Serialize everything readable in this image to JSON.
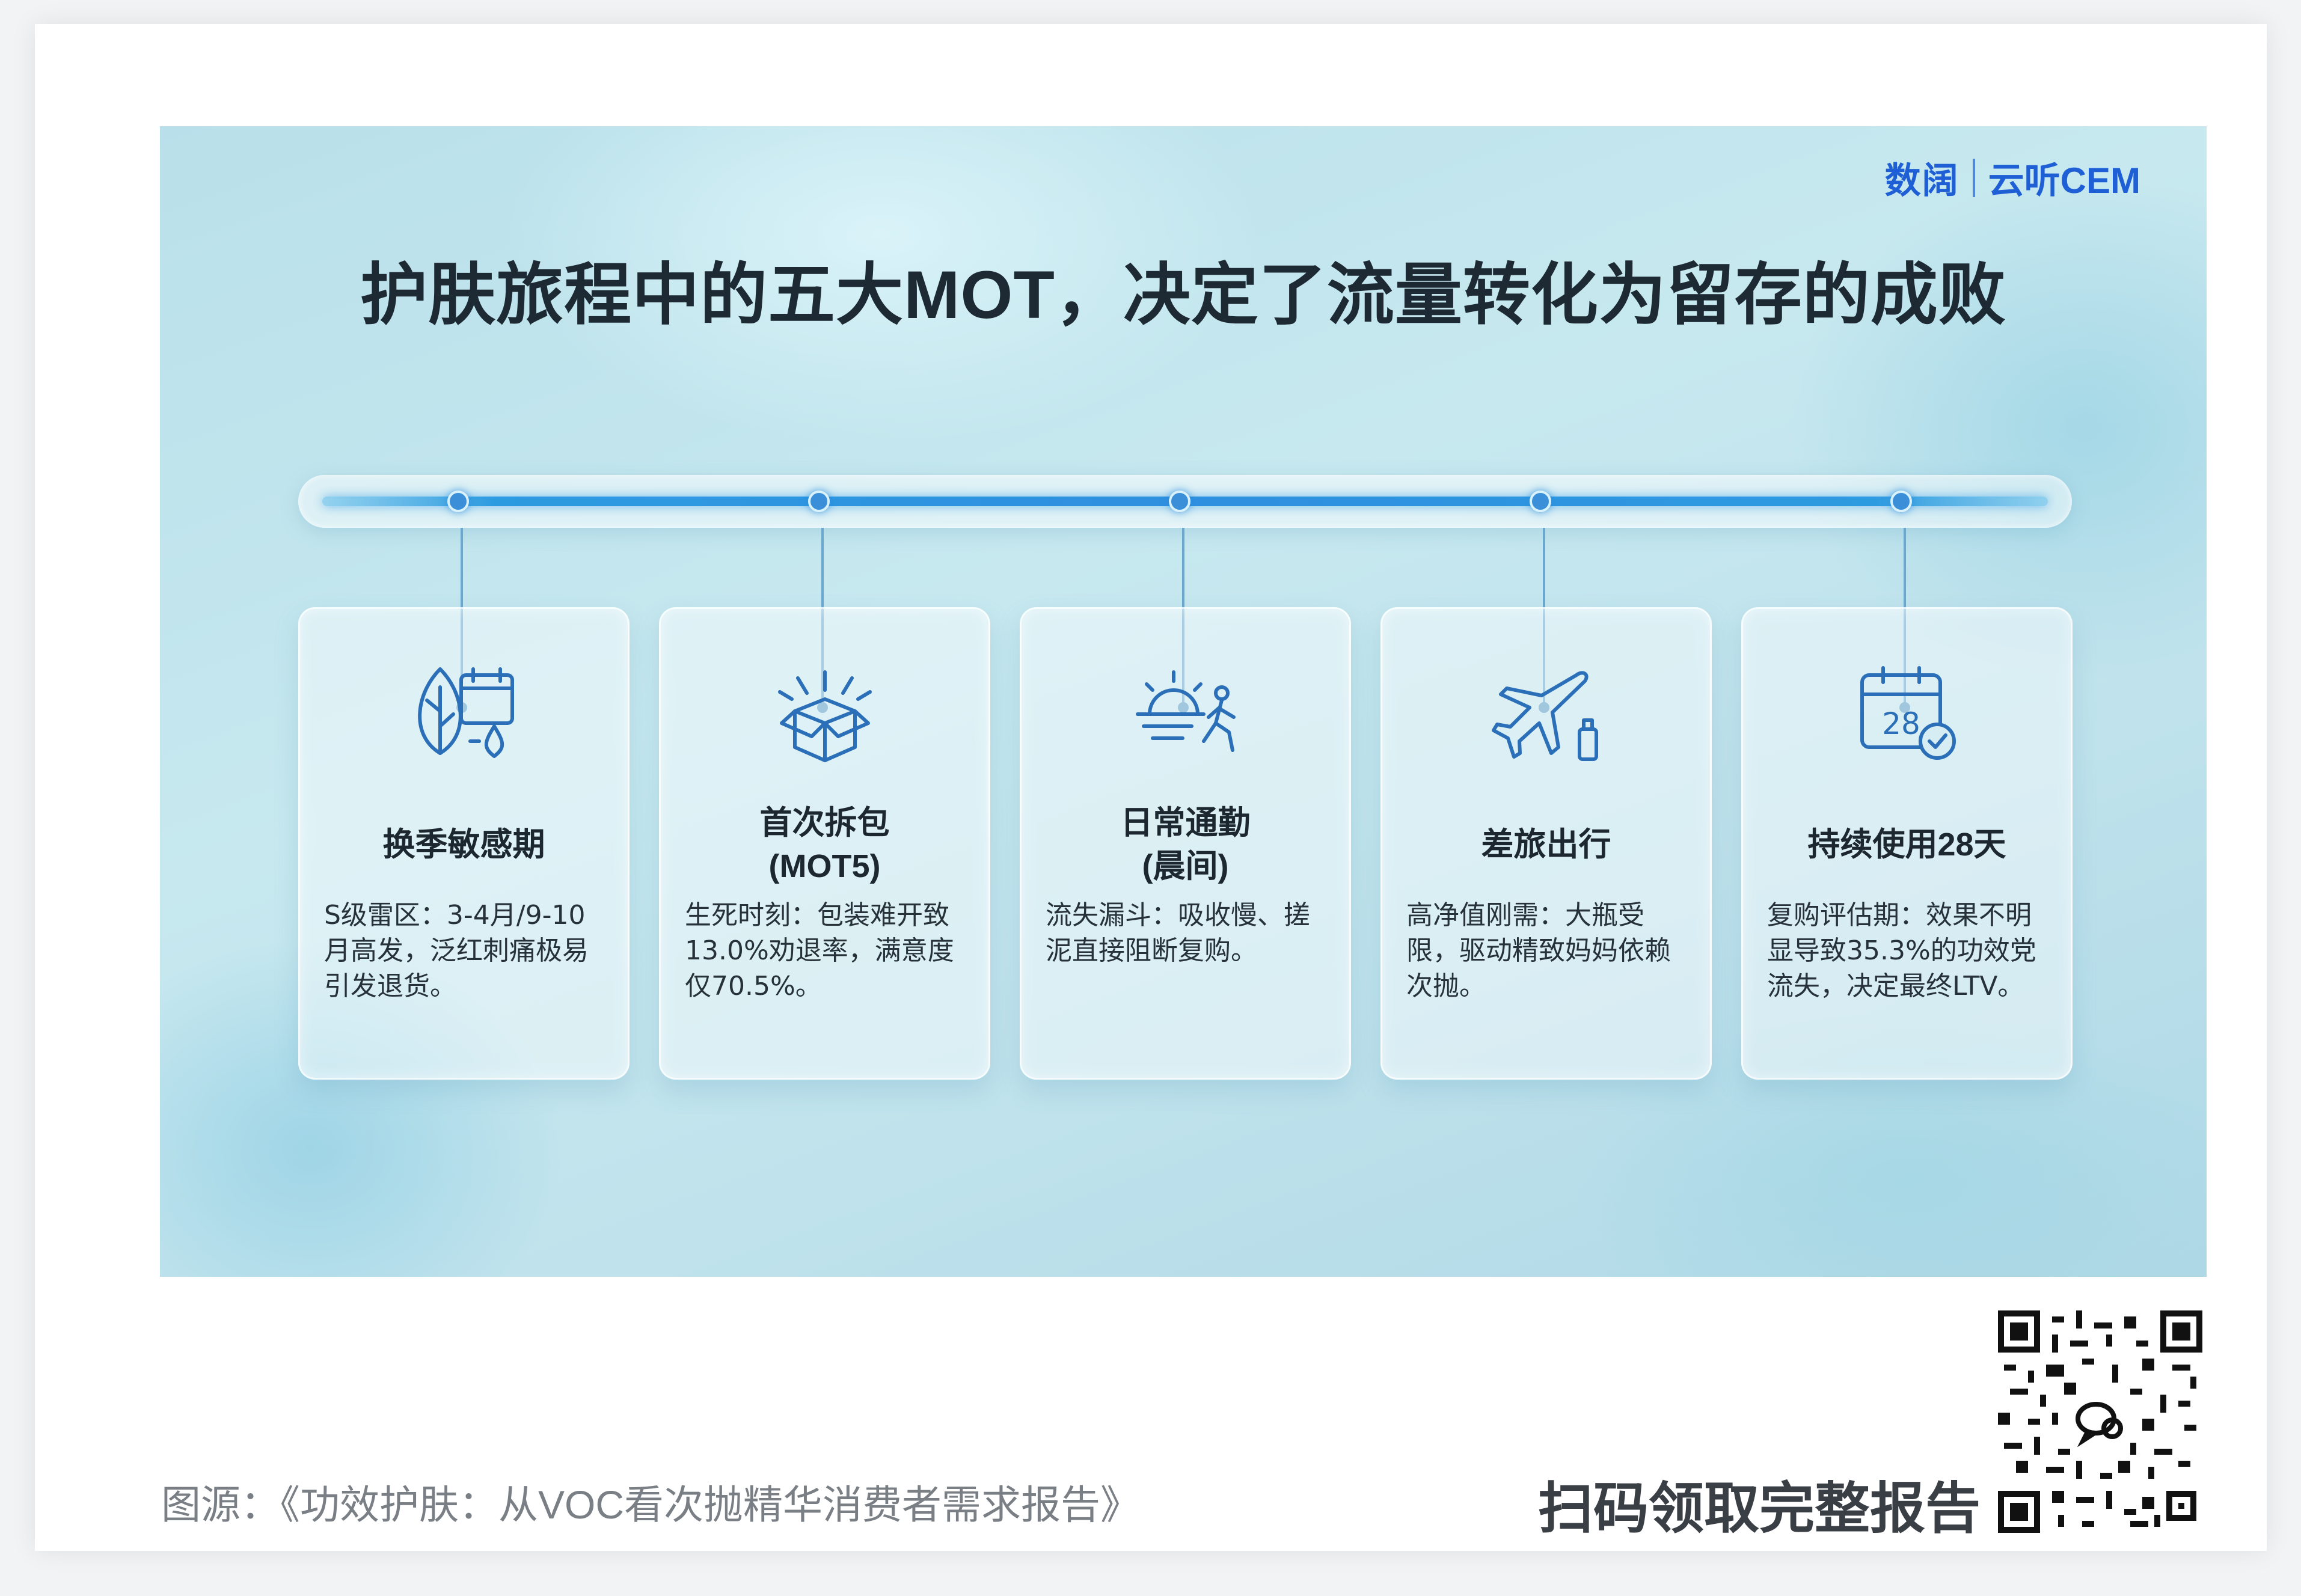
{
  "brand": {
    "logo_text": "数阔",
    "product": "云听CEM"
  },
  "title": "护肤旅程中的五大MOT，决定了流量转化为留存的成败",
  "cards": [
    {
      "icon": "leaf-calendar-drop-icon",
      "label": "换季敏感期",
      "desc": "S级雷区：3-4月/9-10月高发，泛红刺痛极易引发退货。"
    },
    {
      "icon": "open-box-icon",
      "label": "首次拆包\n(MOT5)",
      "desc": "生死时刻：包装难开致13.0%劝退率，满意度仅70.5%。"
    },
    {
      "icon": "sunrise-walker-icon",
      "label": "日常通勤\n(晨间)",
      "desc": "流失漏斗：吸收慢、搓泥直接阻断复购。"
    },
    {
      "icon": "airplane-bottle-icon",
      "label": "差旅出行",
      "desc": "高净值刚需：大瓶受限，驱动精致妈妈依赖次抛。"
    },
    {
      "icon": "calendar-28-check-icon",
      "label": "持续使用28天",
      "desc": "复购评估期：效果不明显导致35.3%的功效党流失，决定最终LTV。"
    }
  ],
  "calendar_number": "28",
  "footer": {
    "source": "图源：《功效护肤：从VOC看次抛精华消费者需求报告》",
    "cta": "扫码领取完整报告"
  },
  "colors": {
    "accent": "#2f8fe0",
    "icon": "#2a6fb8",
    "title": "#1e2a33"
  }
}
